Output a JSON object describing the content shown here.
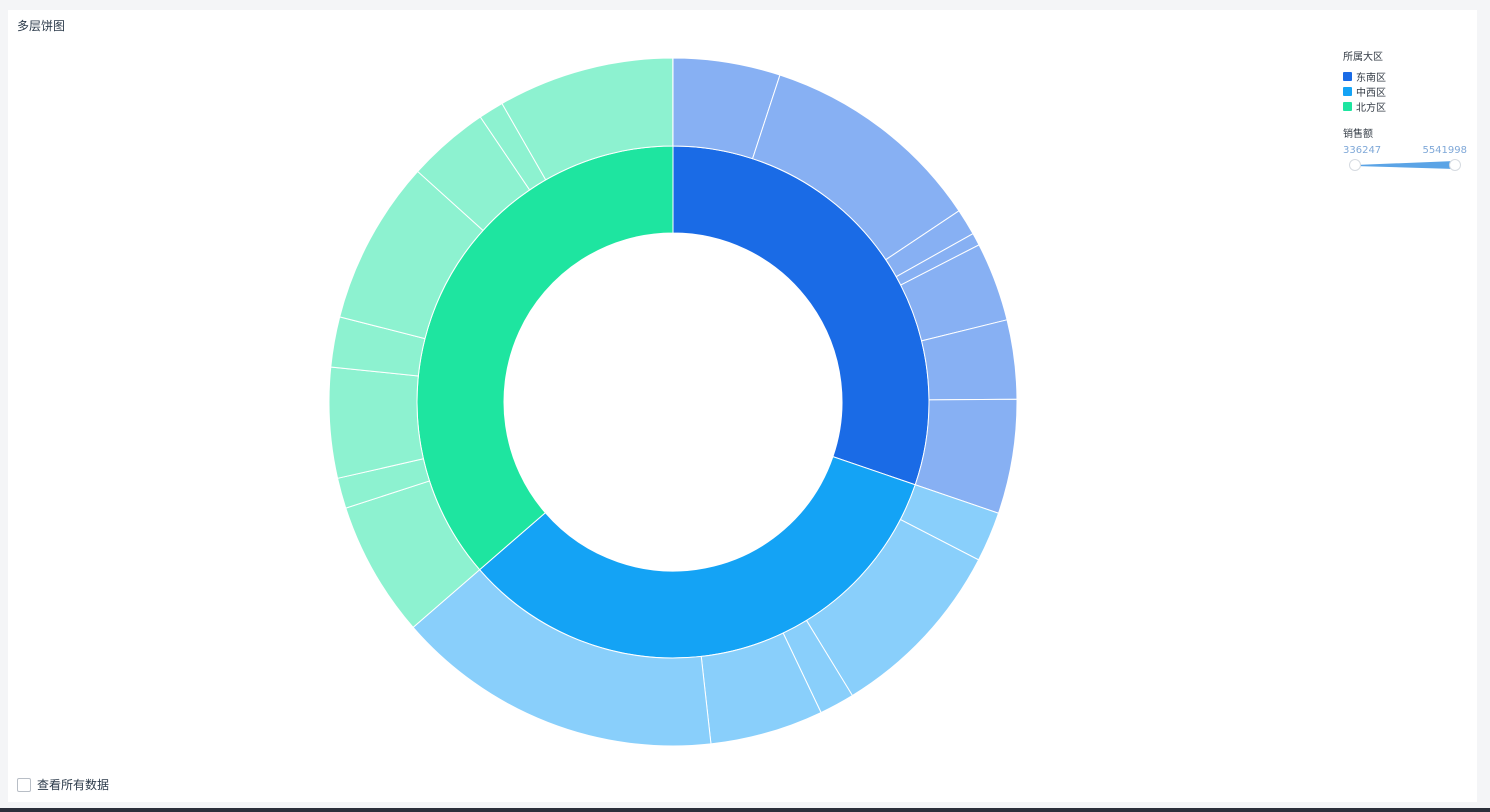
{
  "title": "多层饼图",
  "legend": {
    "title": "所属大区",
    "items": [
      {
        "label": "东南区",
        "color": "#1a6be6"
      },
      {
        "label": "中西区",
        "color": "#14a3f5"
      },
      {
        "label": "北方区",
        "color": "#1ee5a0"
      }
    ]
  },
  "range_filter": {
    "title": "销售额",
    "min": "336247",
    "max": "5541998",
    "color": "#5ba4e6"
  },
  "footer": {
    "checkbox_label": "查看所有数据",
    "checked": false
  },
  "chart_data": {
    "type": "pie",
    "start_angle_deg": 0,
    "direction": "clockwise",
    "inner_ring": [
      {
        "name": "东南区",
        "share": 0.3024,
        "color": "#1a6be6"
      },
      {
        "name": "中西区",
        "share": 0.3339,
        "color": "#14a3f5"
      },
      {
        "name": "北方区",
        "share": 0.3637,
        "color": "#1ee5a0"
      }
    ],
    "outer_ring": [
      {
        "parent": "东南区",
        "share": 0.0503,
        "color": "#87b0f3"
      },
      {
        "parent": "东南区",
        "share": 0.1059,
        "color": "#87b0f3"
      },
      {
        "parent": "东南区",
        "share": 0.0124,
        "color": "#87b0f3"
      },
      {
        "parent": "东南区",
        "share": 0.0059,
        "color": "#87b0f3"
      },
      {
        "parent": "东南区",
        "share": 0.0371,
        "color": "#87b0f3"
      },
      {
        "parent": "东南区",
        "share": 0.0371,
        "color": "#87b0f3"
      },
      {
        "parent": "东南区",
        "share": 0.0537,
        "color": "#87b0f3"
      },
      {
        "parent": "中西区",
        "share": 0.0235,
        "color": "#89cffb"
      },
      {
        "parent": "中西区",
        "share": 0.0868,
        "color": "#89cffb"
      },
      {
        "parent": "中西区",
        "share": 0.0165,
        "color": "#89cffb"
      },
      {
        "parent": "中西区",
        "share": 0.0532,
        "color": "#89cffb"
      },
      {
        "parent": "中西区",
        "share": 0.1539,
        "color": "#89cffb"
      },
      {
        "parent": "北方区",
        "share": 0.0638,
        "color": "#8df2d0"
      },
      {
        "parent": "北方区",
        "share": 0.0143,
        "color": "#8df2d0"
      },
      {
        "parent": "北方区",
        "share": 0.0518,
        "color": "#8df2d0"
      },
      {
        "parent": "北方区",
        "share": 0.0236,
        "color": "#8df2d0"
      },
      {
        "parent": "北方区",
        "share": 0.0771,
        "color": "#8df2d0"
      },
      {
        "parent": "北方区",
        "share": 0.0385,
        "color": "#8df2d0"
      },
      {
        "parent": "北方区",
        "share": 0.0118,
        "color": "#8df2d0"
      },
      {
        "parent": "北方区",
        "share": 0.0827,
        "color": "#8df2d0"
      }
    ]
  }
}
